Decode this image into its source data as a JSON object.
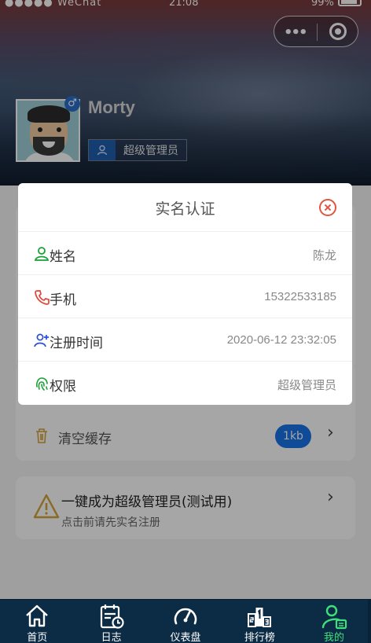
{
  "status_bar": {
    "carrier": "●●●●● WeChat",
    "time": "21:08",
    "battery": "99%"
  },
  "profile": {
    "username": "Morty",
    "gender_symbol": "♂",
    "role": "超级管理员"
  },
  "settings": {
    "clear_cache_label": "清空缓存",
    "cache_size": "1kb",
    "admin_title": "一键成为超级管理员(测试用)",
    "admin_subtitle": "点击前请先实名注册"
  },
  "modal": {
    "title": "实名认证",
    "rows": [
      {
        "icon": "user-icon",
        "label": "姓名",
        "value": "陈龙",
        "color": "#1aa035"
      },
      {
        "icon": "phone-icon",
        "label": "手机",
        "value": "15322533185",
        "color": "#e0443a"
      },
      {
        "icon": "user-add-icon",
        "label": "注册时间",
        "value": "2020-06-12 23:32:05",
        "color": "#2a4fd6"
      },
      {
        "icon": "fingerprint-icon",
        "label": "权限",
        "value": "超级管理员",
        "color": "#1aa035"
      }
    ]
  },
  "tabs": [
    {
      "label": "首页",
      "icon": "home-icon",
      "active": false
    },
    {
      "label": "日志",
      "icon": "log-icon",
      "active": false
    },
    {
      "label": "仪表盘",
      "icon": "dashboard-icon",
      "active": false
    },
    {
      "label": "排行榜",
      "icon": "ranking-icon",
      "active": false
    },
    {
      "label": "我的",
      "icon": "profile-icon",
      "active": true
    }
  ],
  "colors": {
    "accent_blue": "#1a73e8",
    "tabbar_bg": "#0c2c46",
    "active_tab": "#3fe07a",
    "close_red": "#e0563f"
  }
}
